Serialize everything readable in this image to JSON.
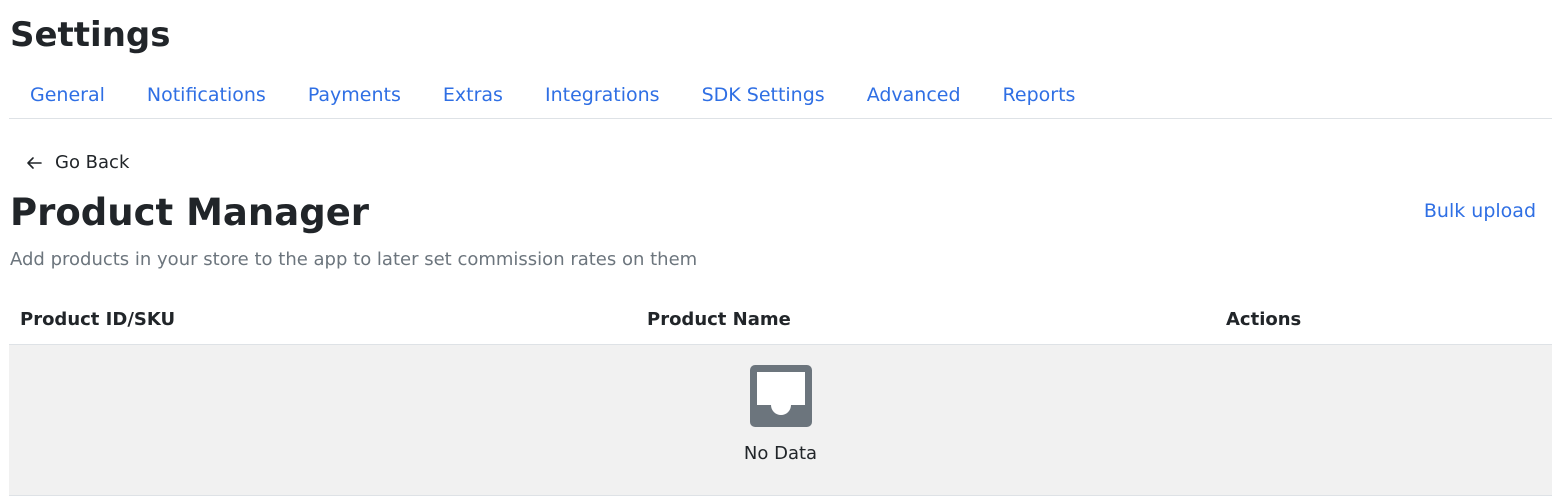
{
  "header": {
    "title": "Settings"
  },
  "tabs": [
    {
      "label": "General"
    },
    {
      "label": "Notifications"
    },
    {
      "label": "Payments"
    },
    {
      "label": "Extras"
    },
    {
      "label": "Integrations"
    },
    {
      "label": "SDK Settings"
    },
    {
      "label": "Advanced"
    },
    {
      "label": "Reports"
    }
  ],
  "nav": {
    "go_back_label": "Go Back",
    "go_back_icon": "arrow-left-icon"
  },
  "section": {
    "title": "Product Manager",
    "subtitle": "Add products in your store to the app to later set commission rates on them",
    "bulk_upload_label": "Bulk upload"
  },
  "table": {
    "columns": [
      {
        "label": "Product ID/SKU"
      },
      {
        "label": "Product Name"
      },
      {
        "label": "Actions"
      }
    ],
    "rows": [],
    "empty_text": "No Data",
    "empty_icon": "inbox-icon"
  },
  "colors": {
    "link": "#2f6fe4",
    "empty_background": "#f1f1f1",
    "empty_icon": "#6c757d",
    "border": "#dee2e6"
  }
}
